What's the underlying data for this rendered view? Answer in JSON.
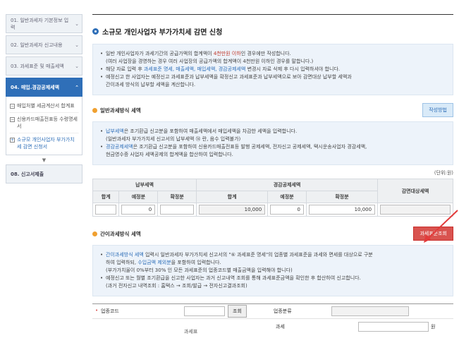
{
  "sidebar": {
    "steps": [
      {
        "label": "01. 일반과세자 기본정보 입력"
      },
      {
        "label": "02. 일반과세자 신고내용"
      },
      {
        "label": "03. 과세표준 및 매출세액"
      },
      {
        "label": "04. 매입.경감공제세액"
      }
    ],
    "sub_items": [
      {
        "label": "매입처별 세금계산서 합계표",
        "mark": "−"
      },
      {
        "label": "신용카드매출전표등 수령명세서",
        "mark": "−"
      },
      {
        "label": "소규모 개인사업자 부가가치세 감면 신청서",
        "mark": "+"
      }
    ],
    "down_arrow": "▼",
    "last_step": {
      "label": "08. 신고서제출"
    }
  },
  "main": {
    "title": "소규모 개인사업자 부가가치세 감면 신청",
    "notice": {
      "l1_pre": "일반 개인사업자가 과세기간의 공급가액의 합계액이 ",
      "l1_hl": "4천만원 이하",
      "l1_post": "인 경우에만 작성합니다.",
      "l2": "(여러 사업장을 경영하는 경우 여러 사업장의 공급가액의 합계액이 4천만원 이하인 경우를 말합니다.)",
      "l3_pre": "해당 자료 입력 후 ",
      "l3_hl": "과세표준 명세, 매출세액, 매입세액, 경감공제세액",
      "l3_post": "변경시 자료 삭제 후 다시 입력하셔야 합니다.",
      "l4": "예정신고 한 사업자는 예정신고 과세표준과 납부세액을 확정신고 과세표준과 납부세액으로 보아 감면대상 납부할 세액과",
      "l5": "간이과세 방식의 납부할 세액을 계산합니다."
    },
    "sec1": {
      "title": "일반과세방식 세액",
      "button": "작성방법",
      "n1_hl": "납부세액",
      "n1": "은 조기환급 신고분을 포함하여 매출세액에서 매입세액을 차감한 세액을 입력합니다.",
      "n2": "(일반과세자 부가가치세 신고서의 납부세액 ⑭ 란, 음수 입력불가)",
      "n3_hl": "경감공제세액",
      "n3": "은 조기환급 신고분을 포함하여 신용카드매출전표등 발행 공제세액, 전자신고 공제세액, 택시운송사업자 경감세액,",
      "n4": "현금영수증 사업자 세액공제의 합계액을 합산하여 입력합니다."
    },
    "unit": "(단위:원)",
    "table": {
      "group1": "납부세액",
      "group2": "경감공제세액",
      "group3": "감면대상세액",
      "sub": [
        "합계",
        "예정분",
        "확정분",
        "합계",
        "예정분",
        "확정분"
      ],
      "values": [
        "",
        "0",
        "",
        "10,000",
        "0",
        "10,000",
        ""
      ]
    },
    "sec2": {
      "title": "간이과세방식 세액",
      "button": "과세표준조회",
      "n1_hl": "간이과세방식 세액",
      "n1": " 입력시 일반과세자 부가가치세 신고서의 \"⑥ 과세표준 명세\"의 업종별 과세표준을 과세와 면세를 대상으로 구분",
      "n2_pre": "하여 입력하되, ",
      "n2_hl": "수입금액 제외분",
      "n2_post": "을 포함하여 입력합니다.",
      "n3": "(부가가치율이 0%부터 30% 인 모든 과세표준의 업종코드별 매출금액을 입력해야 합니다)",
      "n4": "예정신고 또는 월별 조기환급을 신고한 사업자는 과거 신고내역 조회를 통해 과세표준금액을 확인한 후 합산하여 신고합니다.",
      "n5": "(과거 전자신고 내역조회 : 홈택스 → 조회/발급 → 전자신고결과조회)"
    },
    "form": {
      "req_mark": "•",
      "code_label": "업종코드",
      "lookup_button": "조회",
      "cat_label": "업종분류",
      "tax_label": "과세",
      "won": "원",
      "partial": "과세표"
    }
  }
}
